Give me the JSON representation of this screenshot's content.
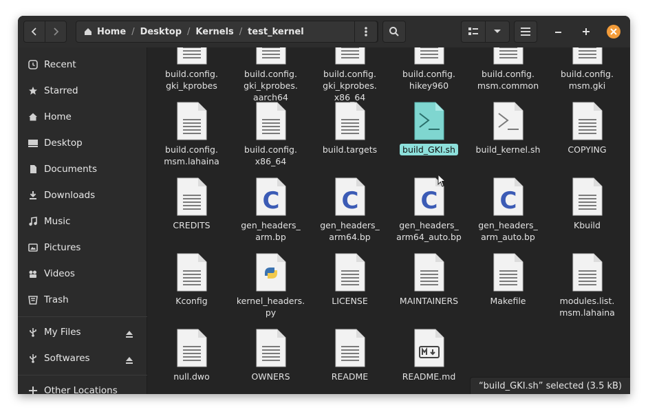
{
  "breadcrumbs": [
    "Home",
    "Desktop",
    "Kernels",
    "test_kernel"
  ],
  "sidebar": {
    "places": [
      {
        "label": "Recent",
        "icon": "clock-icon"
      },
      {
        "label": "Starred",
        "icon": "star-icon"
      },
      {
        "label": "Home",
        "icon": "home-icon"
      },
      {
        "label": "Desktop",
        "icon": "desktop-icon"
      },
      {
        "label": "Documents",
        "icon": "document-icon"
      },
      {
        "label": "Downloads",
        "icon": "download-icon"
      },
      {
        "label": "Music",
        "icon": "music-icon"
      },
      {
        "label": "Pictures",
        "icon": "picture-icon"
      },
      {
        "label": "Videos",
        "icon": "video-icon"
      },
      {
        "label": "Trash",
        "icon": "trash-icon"
      }
    ],
    "devices": [
      {
        "label": "My Files",
        "icon": "usb-icon"
      },
      {
        "label": "Softwares",
        "icon": "usb-icon"
      }
    ],
    "other": {
      "label": "Other Locations",
      "icon": "plus-icon"
    }
  },
  "files": [
    {
      "name": "build.config.\ngki_kprobes",
      "type": "text"
    },
    {
      "name": "build.config.\ngki_kprobes.\naarch64",
      "type": "text"
    },
    {
      "name": "build.config.\ngki_kprobes.\nx86_64",
      "type": "text"
    },
    {
      "name": "build.config.\nhikey960",
      "type": "text"
    },
    {
      "name": "build.config.\nmsm.common",
      "type": "text"
    },
    {
      "name": "build.config.\nmsm.gki",
      "type": "text"
    },
    {
      "name": "build.config.\nmsm.lahaina",
      "type": "text"
    },
    {
      "name": "build.config.\nx86_64",
      "type": "text"
    },
    {
      "name": "build.targets",
      "type": "text"
    },
    {
      "name": "build_GKI.sh",
      "type": "script",
      "selected": true
    },
    {
      "name": "build_kernel.sh",
      "type": "script"
    },
    {
      "name": "COPYING",
      "type": "text"
    },
    {
      "name": "CREDITS",
      "type": "text"
    },
    {
      "name": "gen_headers_\narm.bp",
      "type": "c"
    },
    {
      "name": "gen_headers_\narm64.bp",
      "type": "c"
    },
    {
      "name": "gen_headers_\narm64_auto.bp",
      "type": "c"
    },
    {
      "name": "gen_headers_\narm_auto.bp",
      "type": "c"
    },
    {
      "name": "Kbuild",
      "type": "text"
    },
    {
      "name": "Kconfig",
      "type": "text"
    },
    {
      "name": "kernel_headers.\npy",
      "type": "python"
    },
    {
      "name": "LICENSE",
      "type": "text"
    },
    {
      "name": "MAINTAINERS",
      "type": "text"
    },
    {
      "name": "Makefile",
      "type": "text"
    },
    {
      "name": "modules.list.\nmsm.lahaina",
      "type": "text"
    },
    {
      "name": "null.dwo",
      "type": "text"
    },
    {
      "name": "OWNERS",
      "type": "text"
    },
    {
      "name": "README",
      "type": "text"
    },
    {
      "name": "README.md",
      "type": "markdown"
    }
  ],
  "status": "“build_GKI.sh” selected  (3.5 kB)",
  "colors": {
    "accent": "#8de0db",
    "close": "#f39c3a",
    "c_letter": "#3b5bb5"
  }
}
